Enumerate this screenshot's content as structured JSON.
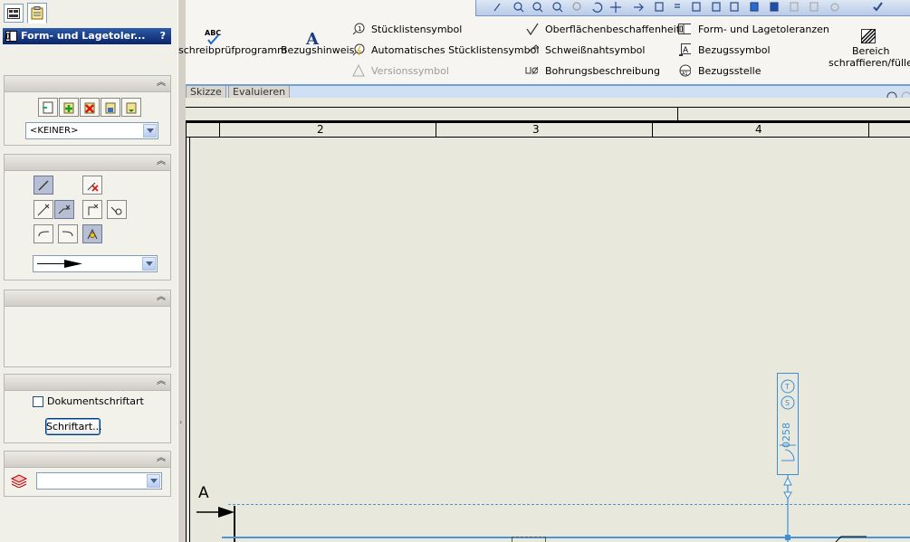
{
  "property_manager": {
    "title": "Form- und Lagetoler...",
    "help_label": "?",
    "style_combo_value": "<KEINER>",
    "leader_combo_value": "",
    "layer_combo_value": "",
    "doc_font_checkbox_label": "Dokumentschriftart",
    "font_button_label": "Schriftart..."
  },
  "ribbon": {
    "spellcheck_label": "schreibprüfprogramm",
    "note_label": "Bezugshinweis",
    "balloon_label": "Stücklistensymbol",
    "auto_balloon_label": "Automatisches Stücklistensymbol",
    "revision_label": "Versionssymbol",
    "surface_finish_label": "Oberflächenbeschaffenheit",
    "weld_symbol_label": "Schweißnahtsymbol",
    "hole_callout_label": "Bohrungsbeschreibung",
    "gtol_label": "Form- und Lagetoleranzen",
    "datum_feature_label": "Bezugssymbol",
    "datum_target_label": "Bezugsstelle",
    "hatch_label_line1": "Bereich",
    "hatch_label_line2": "schraffieren/füllen"
  },
  "ribbon_tabs": [
    "Skizze",
    "Evaluieren"
  ],
  "sheet": {
    "zone_numbers": [
      "2",
      "3",
      "4"
    ],
    "section_label": "A",
    "callout_text": "0258"
  }
}
